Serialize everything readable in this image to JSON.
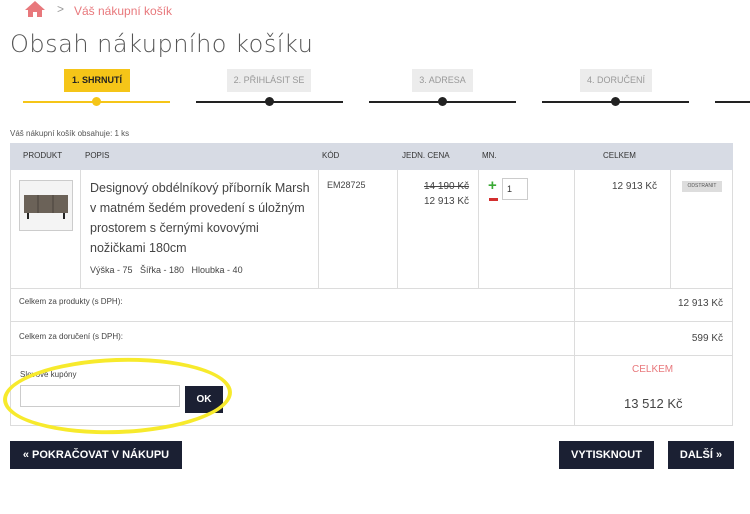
{
  "breadcrumb": {
    "home_icon": "home-icon",
    "separator": ">",
    "current": "Váš nákupní košík"
  },
  "page": {
    "title": "Obsah nákupního košíku"
  },
  "steps": [
    {
      "label": "1. Shrnutí",
      "active": true
    },
    {
      "label": "2. Přihlásit se",
      "active": false
    },
    {
      "label": "3. Adresa",
      "active": false
    },
    {
      "label": "4. Doručení",
      "active": false
    }
  ],
  "cart": {
    "summary": "Váš nákupní košík obsahuje: 1 ks",
    "headers": {
      "product": "Produkt",
      "description": "Popis",
      "code": "Kód",
      "unit_price": "Jedn. cena",
      "qty": "Mn.",
      "total": "Celkem"
    },
    "item": {
      "name": "Designový obdélníkový příborník Marsh v matném šedém provedení s úložným prostorem s černými kovovými nožičkami 180cm",
      "dimensions": "Výška - 75   Šířka - 180   Hloubka - 40",
      "code": "EM28725",
      "old_price": "14 190 Kč",
      "price": "12 913 Kč",
      "quantity": "1",
      "plus": "+",
      "line_total": "12 913 Kč",
      "remove_label": "Odstranit"
    },
    "products_total_label": "Celkem za produkty (s DPH):",
    "products_total": "12 913 Kč",
    "delivery_total_label": "Celkem za doručení (s DPH):",
    "delivery_total": "599 Kč",
    "coupon_label": "Slevové kupóny",
    "coupon_value": "",
    "ok_label": "OK",
    "grand_total_label": "Celkem",
    "grand_total": "13 512 Kč"
  },
  "actions": {
    "continue_label": "« Pokračovat v nákupu",
    "print_label": "Vytisknout",
    "next_label": "Další »"
  },
  "colors": {
    "accent": "#f5c518",
    "dark": "#1b2033",
    "link": "#e8787c",
    "header_bg": "#d7dbe4"
  }
}
